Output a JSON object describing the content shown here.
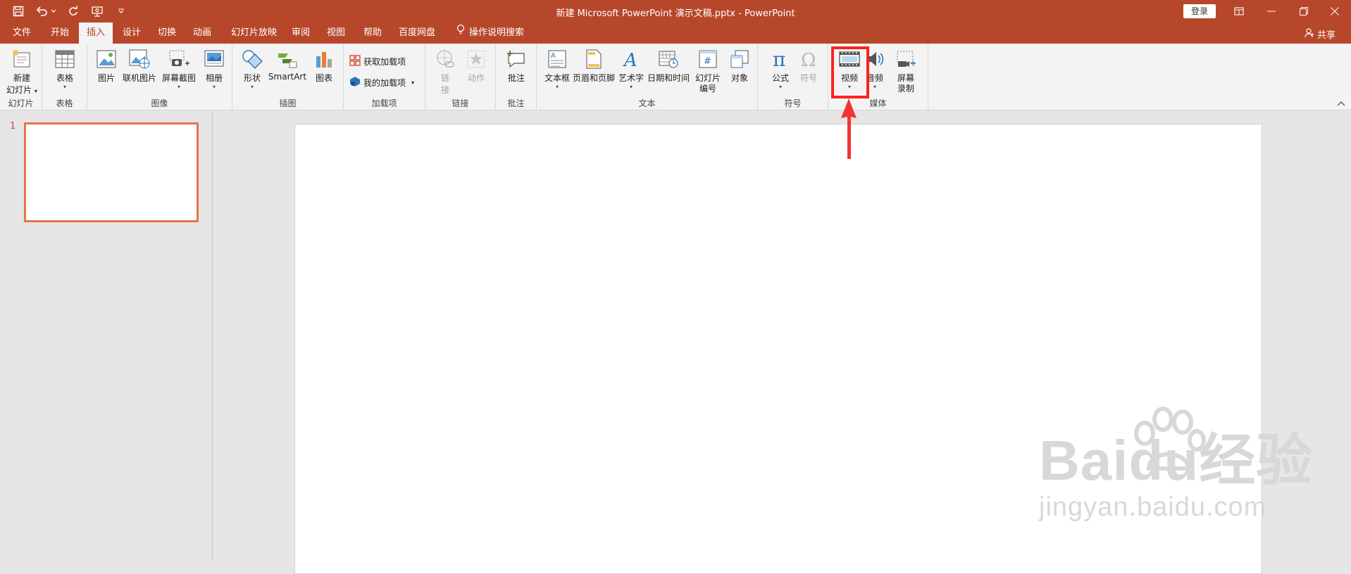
{
  "titlebar": {
    "title": "新建 Microsoft PowerPoint 演示文稿.pptx  -  PowerPoint",
    "login_label": "登录",
    "colors": {
      "bar": "#b7472a"
    }
  },
  "tabs": [
    {
      "label": "文件"
    },
    {
      "label": "开始"
    },
    {
      "label": "插入",
      "active": true
    },
    {
      "label": "设计"
    },
    {
      "label": "切换"
    },
    {
      "label": "动画"
    },
    {
      "label": "幻灯片放映"
    },
    {
      "label": "审阅"
    },
    {
      "label": "视图"
    },
    {
      "label": "帮助"
    },
    {
      "label": "百度网盘"
    },
    {
      "label": "操作说明搜索"
    }
  ],
  "share_label": "共享",
  "ribbon": {
    "groups": {
      "slides": {
        "label": "幻灯片",
        "new_slide_line1": "新建",
        "new_slide_line2": "幻灯片"
      },
      "table": {
        "label": "表格",
        "table_btn": "表格"
      },
      "images": {
        "label": "图像",
        "picture": "图片",
        "online_picture": "联机图片",
        "screenshot": "屏幕截图",
        "album": "相册"
      },
      "illustrations": {
        "label": "插图",
        "shapes": "形状",
        "smartart": "SmartArt",
        "chart": "图表"
      },
      "addins": {
        "label": "加载项",
        "get_addins": "获取加载项",
        "my_addins": "我的加载项"
      },
      "links": {
        "label": "链接",
        "link_line1": "链",
        "link_line2": "接",
        "action": "动作"
      },
      "comments": {
        "label": "批注",
        "comment_btn": "批注"
      },
      "text": {
        "label": "文本",
        "textbox": "文本框",
        "header_footer": "页眉和页脚",
        "wordart": "艺术字",
        "datetime": "日期和时间",
        "slide_number_line1": "幻灯片",
        "slide_number_line2": "编号",
        "object": "对象"
      },
      "symbols": {
        "label": "符号",
        "equation": "公式",
        "symbol": "符号"
      },
      "media": {
        "label": "媒体",
        "video": "视频",
        "audio": "音频",
        "screen_rec_line1": "屏幕",
        "screen_rec_line2": "录制"
      }
    }
  },
  "slides_panel": {
    "slide_number": "1"
  },
  "highlight_color": "#ff2020",
  "watermark": {
    "line1": "Baidu经验",
    "line2": "jingyan.baidu.com"
  }
}
